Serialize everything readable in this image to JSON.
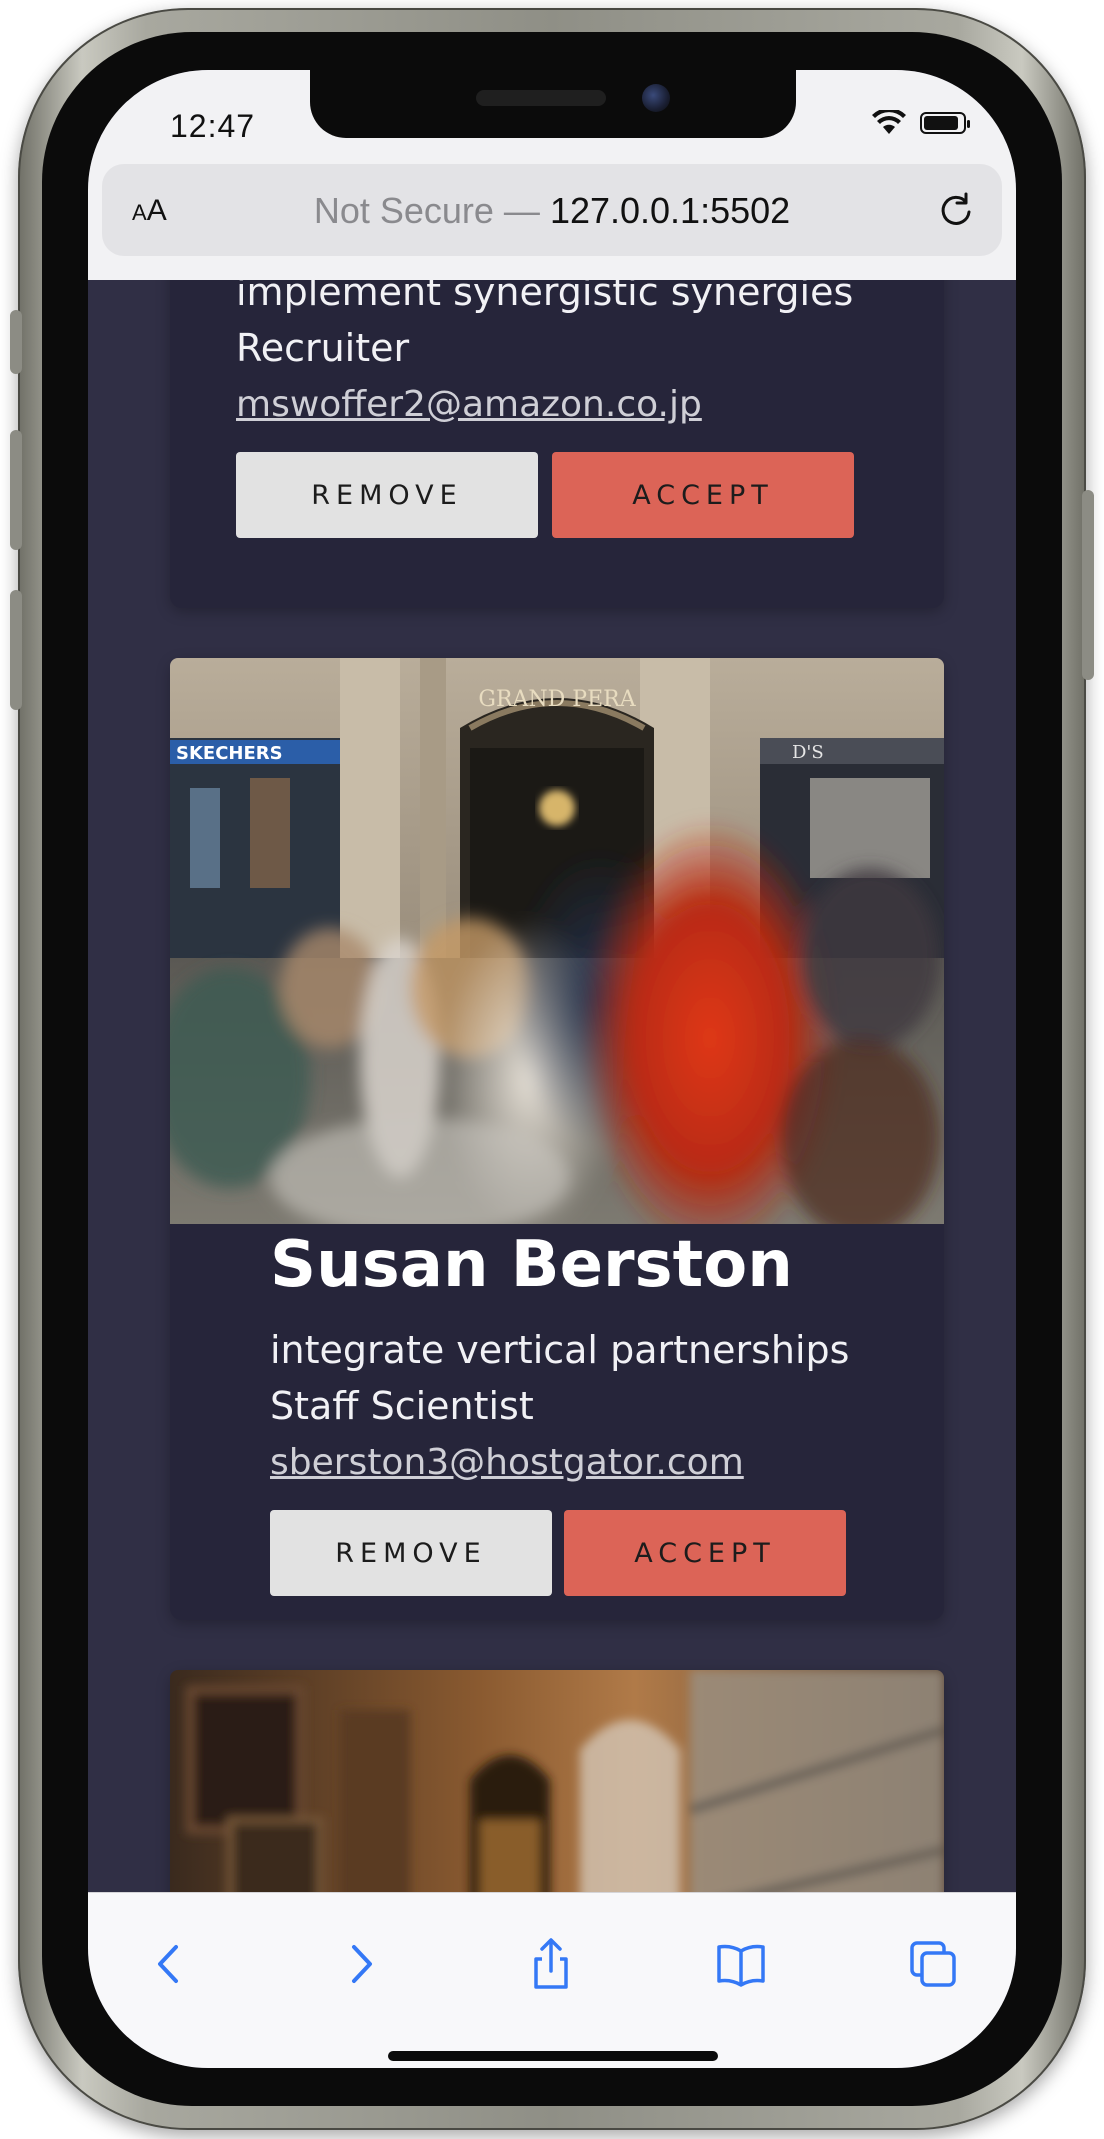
{
  "status_bar": {
    "time": "12:47"
  },
  "browser": {
    "text_size_label": "AA",
    "security_label": "Not Secure —",
    "url": "127.0.0.1:5502"
  },
  "cards": [
    {
      "tagline": "implement synergistic synergies",
      "role": "Recruiter",
      "email": "mswoffer2@amazon.co.jp",
      "remove_label": "REMOVE",
      "accept_label": "ACCEPT"
    },
    {
      "name": "Susan Berston",
      "tagline": "integrate vertical partnerships",
      "role": "Staff Scientist",
      "email": "sberston3@hostgator.com",
      "remove_label": "REMOVE",
      "accept_label": "ACCEPT"
    }
  ],
  "photo_signs": {
    "store_left": "SKECHERS",
    "arch": "GRAND PERA",
    "store_right": "D'S"
  },
  "colors": {
    "page_bg": "#302f45",
    "card_bg": "#26253a",
    "accept": "#dc6457",
    "remove": "#e2e2e2",
    "ios_blue": "#3478f6"
  },
  "toolbar_icons": [
    "back-chevron-icon",
    "forward-chevron-icon",
    "share-icon",
    "bookmarks-icon",
    "tabs-icon"
  ]
}
